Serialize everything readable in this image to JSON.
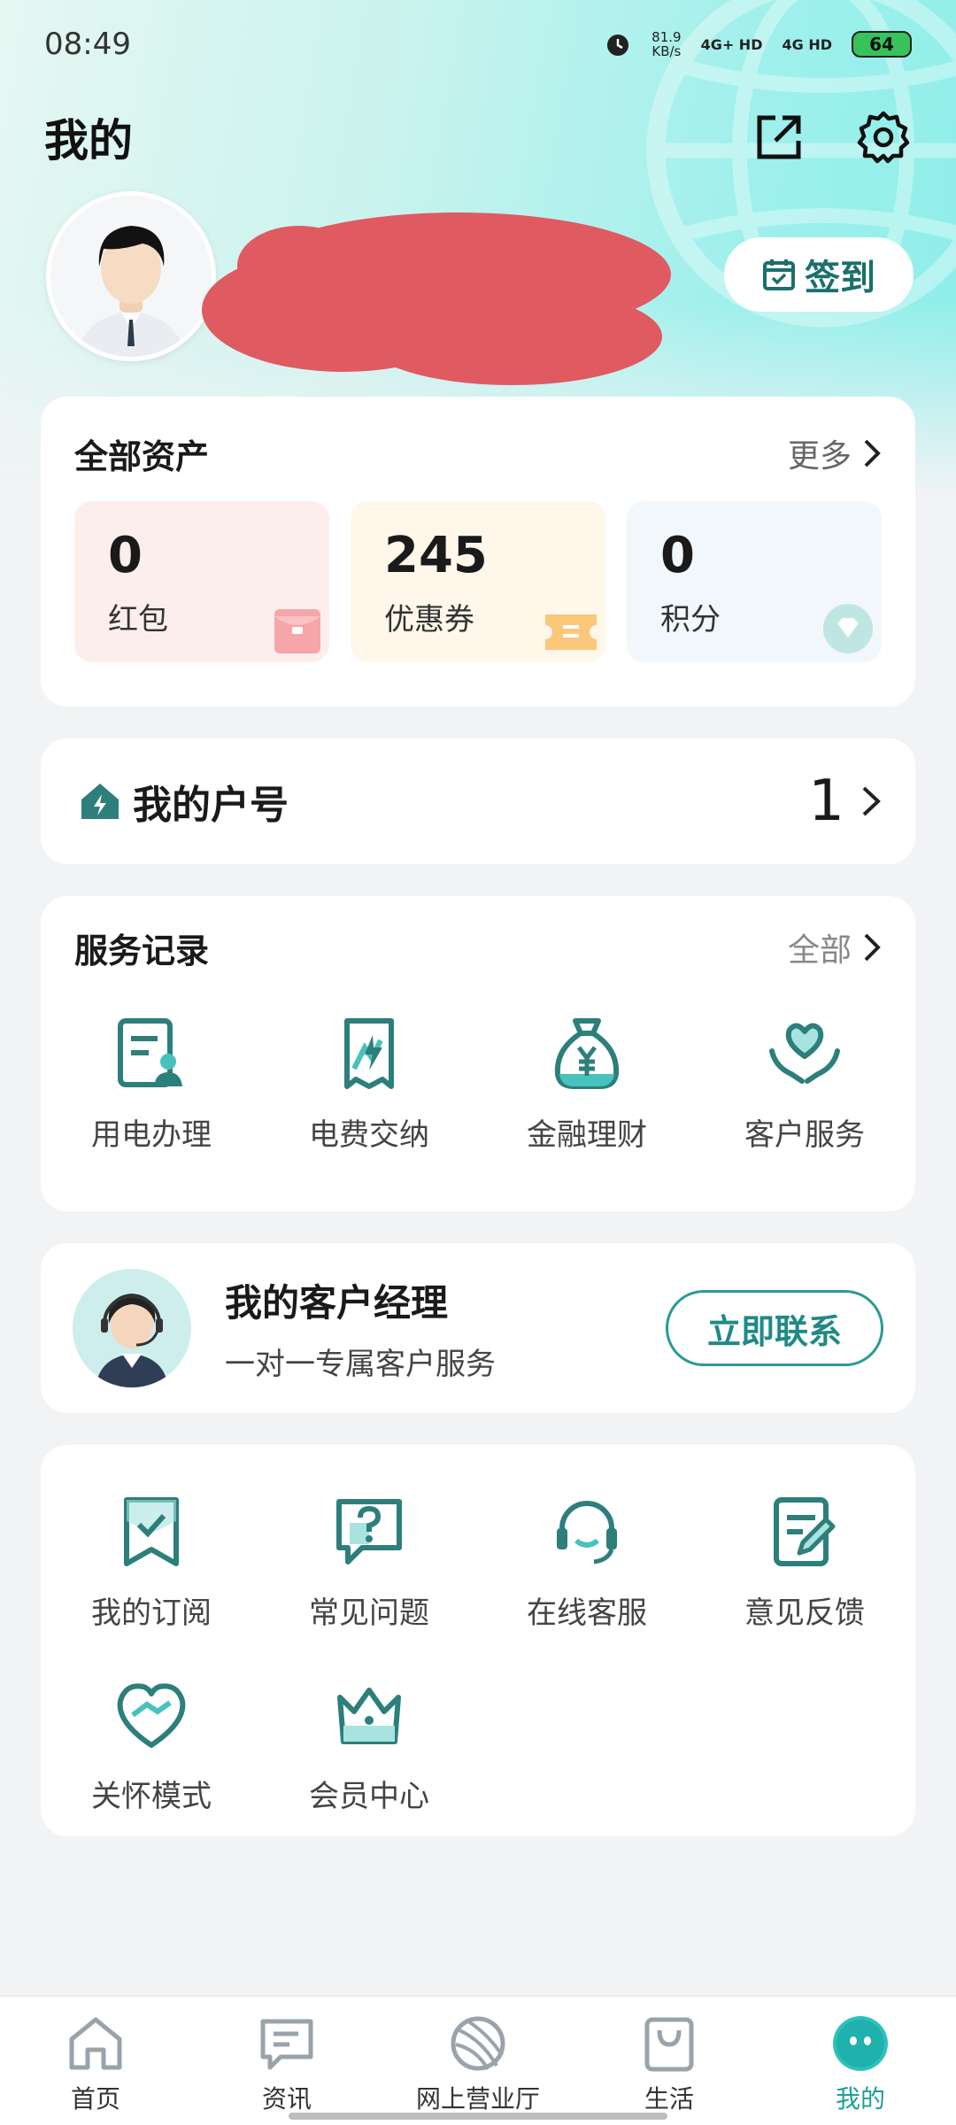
{
  "status_bar": {
    "time": "08:49",
    "net_speed": "81.9",
    "net_unit": "KB/s",
    "sim1": "4G+ HD",
    "sim2": "4G HD",
    "battery": "64"
  },
  "header": {
    "title": "我的",
    "share_icon": "external-link-icon",
    "settings_icon": "gear-icon"
  },
  "profile": {
    "checkin_label": "签到"
  },
  "assets": {
    "title": "全部资产",
    "more_label": "更多",
    "items": [
      {
        "value": "0",
        "label": "红包",
        "bg": "#fdeeee",
        "icon": "red-envelope-icon"
      },
      {
        "value": "245",
        "label": "优惠券",
        "bg": "#fff7ea",
        "icon": "coupon-icon"
      },
      {
        "value": "0",
        "label": "积分",
        "bg": "#f1f7fb",
        "icon": "diamond-icon"
      }
    ]
  },
  "account": {
    "label": "我的户号",
    "count": "1"
  },
  "services": {
    "title": "服务记录",
    "all_label": "全部",
    "items": [
      {
        "label": "用电办理",
        "icon": "electricity-application-icon"
      },
      {
        "label": "电费交纳",
        "icon": "bill-payment-icon"
      },
      {
        "label": "金融理财",
        "icon": "money-bag-icon"
      },
      {
        "label": "客户服务",
        "icon": "heart-hands-icon"
      }
    ]
  },
  "manager": {
    "title": "我的客户经理",
    "subtitle": "一对一专属客户服务",
    "contact_label": "立即联系"
  },
  "tools": {
    "items": [
      {
        "label": "我的订阅",
        "icon": "bookmark-check-icon"
      },
      {
        "label": "常见问题",
        "icon": "question-icon"
      },
      {
        "label": "在线客服",
        "icon": "headset-icon"
      },
      {
        "label": "意见反馈",
        "icon": "feedback-edit-icon"
      },
      {
        "label": "关怀模式",
        "icon": "care-heart-icon"
      },
      {
        "label": "会员中心",
        "icon": "crown-icon"
      }
    ]
  },
  "nav": {
    "items": [
      {
        "label": "首页",
        "icon": "home-icon"
      },
      {
        "label": "资讯",
        "icon": "message-icon"
      },
      {
        "label": "网上营业厅",
        "icon": "globe-icon"
      },
      {
        "label": "生活",
        "icon": "shopping-bag-icon"
      },
      {
        "label": "我的",
        "icon": "profile-face-icon"
      }
    ],
    "active_color": "#1f9f9a"
  },
  "colors": {
    "brand": "#1f8a85",
    "icon_teal": "#2c7f7b",
    "icon_accent": "#47c2bc"
  }
}
